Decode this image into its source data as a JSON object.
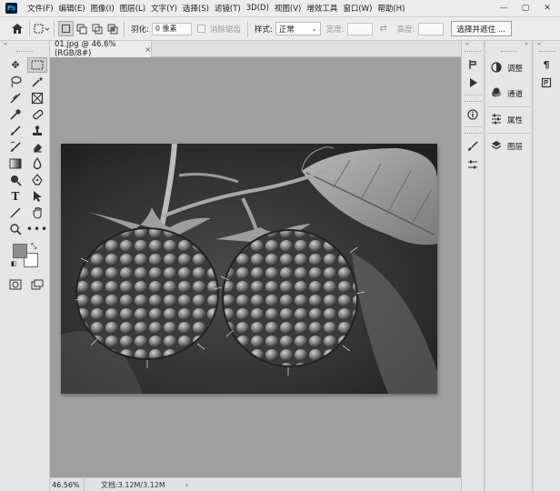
{
  "app": {
    "logo": "Ps",
    "menu": [
      "文件(F)",
      "编辑(E)",
      "图像(I)",
      "图层(L)",
      "文字(Y)",
      "选择(S)",
      "滤镜(T)",
      "3D(D)",
      "视图(V)",
      "增效工具",
      "窗口(W)",
      "帮助(H)"
    ],
    "window_controls": {
      "minimize": "—",
      "restore": "▢",
      "close": "✕"
    }
  },
  "options": {
    "feather_label": "羽化:",
    "feather_value": "0 像素",
    "antialias_label": "消除锯齿",
    "style_label": "样式:",
    "style_value": "正常",
    "width_label": "宽度:",
    "height_label": "高度:",
    "select_mask_button": "选择并遮住 ..."
  },
  "document": {
    "tab_title": "01.jpg @ 46.6%(RGB/8#)",
    "tab_close": "×",
    "zoom": "46.56%",
    "doc_info": "文档:3.12M/3.12M",
    "status_arrow": "›"
  },
  "panels": {
    "items": [
      {
        "icon": "◐",
        "label": "调整"
      },
      {
        "icon": "◕",
        "label": "通道"
      },
      {
        "icon": "☷",
        "label": "属性"
      },
      {
        "icon": "◈",
        "label": "图层"
      }
    ]
  },
  "colors": {
    "foreground": "#8e8e8e",
    "background": "#ffffff",
    "canvas_bg": "#9f9f9f"
  }
}
